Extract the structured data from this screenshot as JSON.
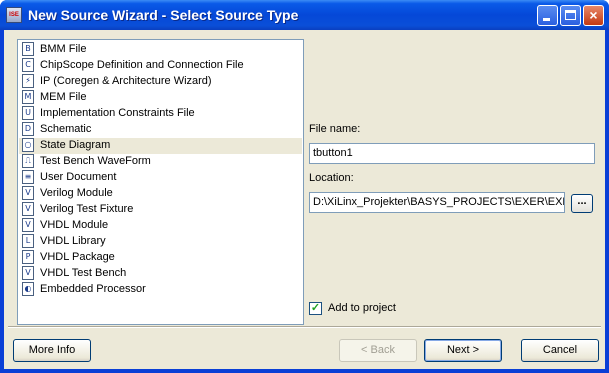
{
  "window": {
    "title": "New Source Wizard - Select Source Type",
    "app_icon": "xilinx-app-icon",
    "controls": [
      "minimize",
      "maximize",
      "close"
    ],
    "close_glyph": "×"
  },
  "source_types": [
    {
      "label": "BMM File",
      "icon": "bmm-file-icon",
      "glyph": "B"
    },
    {
      "label": "ChipScope Definition and Connection File",
      "icon": "chipscope-icon",
      "glyph": "C"
    },
    {
      "label": "IP (Coregen & Architecture Wizard)",
      "icon": "ip-wizard-icon",
      "glyph": "⚡"
    },
    {
      "label": "MEM File",
      "icon": "mem-file-icon",
      "glyph": "M"
    },
    {
      "label": "Implementation Constraints File",
      "icon": "constraints-file-icon",
      "glyph": "U"
    },
    {
      "label": "Schematic",
      "icon": "schematic-icon",
      "glyph": "D"
    },
    {
      "label": "State Diagram",
      "icon": "state-diagram-icon",
      "glyph": "○",
      "selected": true
    },
    {
      "label": "Test Bench WaveForm",
      "icon": "waveform-icon",
      "glyph": "⎍"
    },
    {
      "label": "User Document",
      "icon": "document-icon",
      "glyph": "≡"
    },
    {
      "label": "Verilog Module",
      "icon": "verilog-module-icon",
      "glyph": "V"
    },
    {
      "label": "Verilog Test Fixture",
      "icon": "verilog-fixture-icon",
      "glyph": "V"
    },
    {
      "label": "VHDL Module",
      "icon": "vhdl-module-icon",
      "glyph": "V"
    },
    {
      "label": "VHDL Library",
      "icon": "vhdl-library-icon",
      "glyph": "L"
    },
    {
      "label": "VHDL Package",
      "icon": "vhdl-package-icon",
      "glyph": "P"
    },
    {
      "label": "VHDL Test Bench",
      "icon": "vhdl-testbench-icon",
      "glyph": "V"
    },
    {
      "label": "Embedded Processor",
      "icon": "embedded-processor-icon",
      "glyph": "◐"
    }
  ],
  "file_name": {
    "label": "File name:",
    "value": "tbutton1"
  },
  "location": {
    "label": "Location:",
    "value": "D:\\XiLinx_Projekter\\BASYS_PROJECTS\\EXER\\EXE",
    "browse_label": "..."
  },
  "add_to_project": {
    "label": "Add to project",
    "checked": true,
    "mark": "✓"
  },
  "buttons": {
    "more_info": "More Info",
    "back": "< Back",
    "next": "Next >",
    "cancel": "Cancel"
  }
}
